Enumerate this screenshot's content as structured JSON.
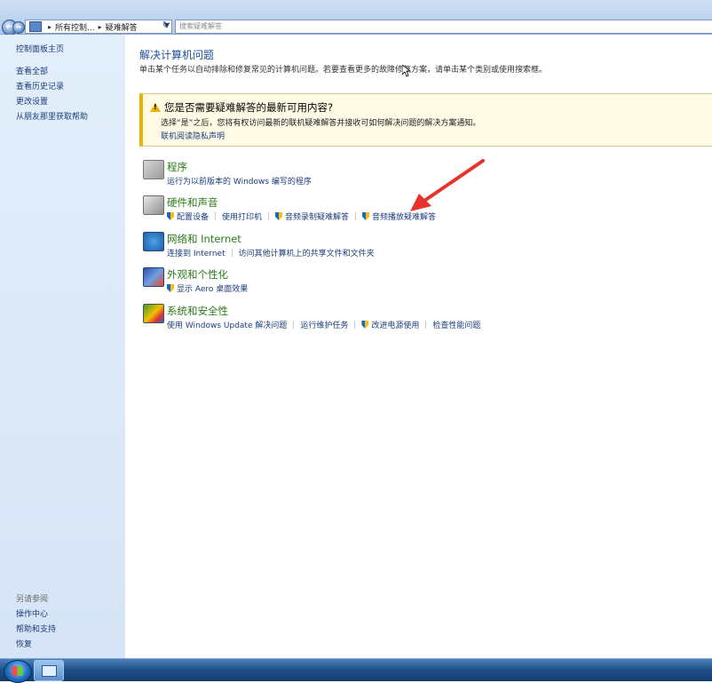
{
  "address_bar": {
    "crumb_root": "所有控制...",
    "crumb_current": "疑难解答",
    "search_placeholder": "搜索疑难解答"
  },
  "sidebar": {
    "top_links": [
      "控制面板主页",
      "查看全部",
      "查看历史记录",
      "更改设置",
      "从朋友那里获取帮助"
    ],
    "see_also_title": "另请参阅",
    "see_also_links": [
      "操作中心",
      "帮助和支持",
      "恢复"
    ]
  },
  "main": {
    "heading": "解决计算机问题",
    "intro": "单击某个任务以自动排除和修复常见的计算机问题。若要查看更多的故障修复方案，请单击某个类别或使用搜索框。",
    "banner": {
      "title": "您是否需要疑难解答的最新可用内容?",
      "description": "选择“是”之后，您将有权访问最新的联机疑难解答并接收可如何解决问题的解决方案通知。",
      "link": "联机阅读隐私声明"
    },
    "categories": [
      {
        "title": "程序",
        "icon": "programs-icon",
        "links": [
          {
            "label": "运行为以前版本的 Windows 编写的程序",
            "shield": false
          }
        ]
      },
      {
        "title": "硬件和声音",
        "icon": "hardware-sound-icon",
        "links": [
          {
            "label": "配置设备",
            "shield": true
          },
          {
            "label": "使用打印机",
            "shield": false
          },
          {
            "label": "音频录制疑难解答",
            "shield": true
          },
          {
            "label": "音频播放疑难解答",
            "shield": true
          }
        ]
      },
      {
        "title": "网络和 Internet",
        "icon": "network-icon",
        "links": [
          {
            "label": "连接到 Internet",
            "shield": false
          },
          {
            "label": "访问其他计算机上的共享文件和文件夹",
            "shield": false
          }
        ]
      },
      {
        "title": "外观和个性化",
        "icon": "appearance-icon",
        "links": [
          {
            "label": "显示 Aero 桌面效果",
            "shield": true
          }
        ]
      },
      {
        "title": "系统和安全性",
        "icon": "system-security-icon",
        "links": [
          {
            "label": "使用 Windows Update 解决问题",
            "shield": false
          },
          {
            "label": "运行维护任务",
            "shield": false
          },
          {
            "label": "改进电源使用",
            "shield": true
          },
          {
            "label": "检查性能问题",
            "shield": false
          }
        ]
      }
    ]
  },
  "colors": {
    "category_title": "#2a7a17",
    "link": "#1b3d7a",
    "heading": "#1f4e9a",
    "banner_bg": "#fffbe5",
    "annotation_arrow": "#e8322a"
  }
}
